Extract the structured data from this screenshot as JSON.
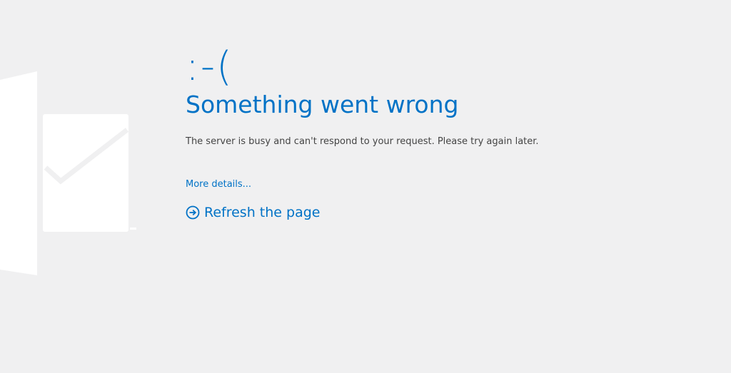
{
  "error": {
    "face": ":-(",
    "title": "Something went wrong",
    "message": "The server is busy and can't respond to your request. Please try again later.",
    "more_details": "More details...",
    "refresh_label": "Refresh the page"
  },
  "icons": {
    "logo": "outlook-envelope-icon",
    "refresh": "arrow-right-circle-icon"
  },
  "colors": {
    "background": "#f0f0f1",
    "accent": "#0072c6",
    "body_text": "#444444",
    "watermark": "#ffffff"
  }
}
